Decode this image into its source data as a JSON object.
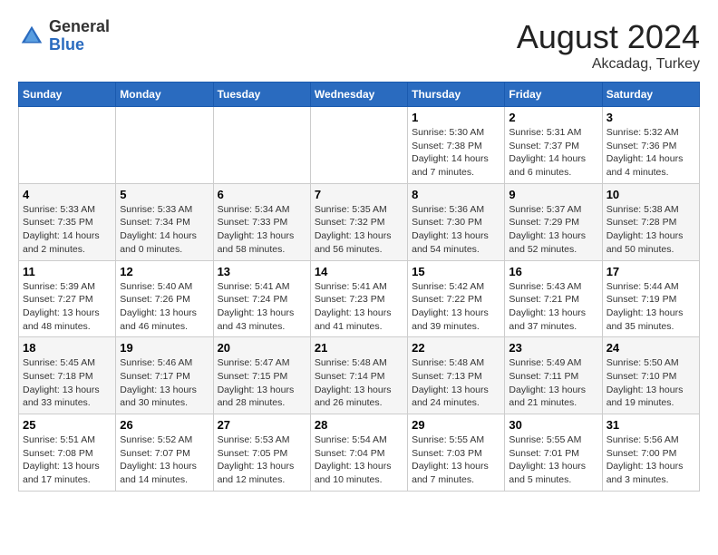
{
  "header": {
    "logo_general": "General",
    "logo_blue": "Blue",
    "month_year": "August 2024",
    "location": "Akcadag, Turkey"
  },
  "weekdays": [
    "Sunday",
    "Monday",
    "Tuesday",
    "Wednesday",
    "Thursday",
    "Friday",
    "Saturday"
  ],
  "weeks": [
    [
      {
        "day": "",
        "info": ""
      },
      {
        "day": "",
        "info": ""
      },
      {
        "day": "",
        "info": ""
      },
      {
        "day": "",
        "info": ""
      },
      {
        "day": "1",
        "info": "Sunrise: 5:30 AM\nSunset: 7:38 PM\nDaylight: 14 hours\nand 7 minutes."
      },
      {
        "day": "2",
        "info": "Sunrise: 5:31 AM\nSunset: 7:37 PM\nDaylight: 14 hours\nand 6 minutes."
      },
      {
        "day": "3",
        "info": "Sunrise: 5:32 AM\nSunset: 7:36 PM\nDaylight: 14 hours\nand 4 minutes."
      }
    ],
    [
      {
        "day": "4",
        "info": "Sunrise: 5:33 AM\nSunset: 7:35 PM\nDaylight: 14 hours\nand 2 minutes."
      },
      {
        "day": "5",
        "info": "Sunrise: 5:33 AM\nSunset: 7:34 PM\nDaylight: 14 hours\nand 0 minutes."
      },
      {
        "day": "6",
        "info": "Sunrise: 5:34 AM\nSunset: 7:33 PM\nDaylight: 13 hours\nand 58 minutes."
      },
      {
        "day": "7",
        "info": "Sunrise: 5:35 AM\nSunset: 7:32 PM\nDaylight: 13 hours\nand 56 minutes."
      },
      {
        "day": "8",
        "info": "Sunrise: 5:36 AM\nSunset: 7:30 PM\nDaylight: 13 hours\nand 54 minutes."
      },
      {
        "day": "9",
        "info": "Sunrise: 5:37 AM\nSunset: 7:29 PM\nDaylight: 13 hours\nand 52 minutes."
      },
      {
        "day": "10",
        "info": "Sunrise: 5:38 AM\nSunset: 7:28 PM\nDaylight: 13 hours\nand 50 minutes."
      }
    ],
    [
      {
        "day": "11",
        "info": "Sunrise: 5:39 AM\nSunset: 7:27 PM\nDaylight: 13 hours\nand 48 minutes."
      },
      {
        "day": "12",
        "info": "Sunrise: 5:40 AM\nSunset: 7:26 PM\nDaylight: 13 hours\nand 46 minutes."
      },
      {
        "day": "13",
        "info": "Sunrise: 5:41 AM\nSunset: 7:24 PM\nDaylight: 13 hours\nand 43 minutes."
      },
      {
        "day": "14",
        "info": "Sunrise: 5:41 AM\nSunset: 7:23 PM\nDaylight: 13 hours\nand 41 minutes."
      },
      {
        "day": "15",
        "info": "Sunrise: 5:42 AM\nSunset: 7:22 PM\nDaylight: 13 hours\nand 39 minutes."
      },
      {
        "day": "16",
        "info": "Sunrise: 5:43 AM\nSunset: 7:21 PM\nDaylight: 13 hours\nand 37 minutes."
      },
      {
        "day": "17",
        "info": "Sunrise: 5:44 AM\nSunset: 7:19 PM\nDaylight: 13 hours\nand 35 minutes."
      }
    ],
    [
      {
        "day": "18",
        "info": "Sunrise: 5:45 AM\nSunset: 7:18 PM\nDaylight: 13 hours\nand 33 minutes."
      },
      {
        "day": "19",
        "info": "Sunrise: 5:46 AM\nSunset: 7:17 PM\nDaylight: 13 hours\nand 30 minutes."
      },
      {
        "day": "20",
        "info": "Sunrise: 5:47 AM\nSunset: 7:15 PM\nDaylight: 13 hours\nand 28 minutes."
      },
      {
        "day": "21",
        "info": "Sunrise: 5:48 AM\nSunset: 7:14 PM\nDaylight: 13 hours\nand 26 minutes."
      },
      {
        "day": "22",
        "info": "Sunrise: 5:48 AM\nSunset: 7:13 PM\nDaylight: 13 hours\nand 24 minutes."
      },
      {
        "day": "23",
        "info": "Sunrise: 5:49 AM\nSunset: 7:11 PM\nDaylight: 13 hours\nand 21 minutes."
      },
      {
        "day": "24",
        "info": "Sunrise: 5:50 AM\nSunset: 7:10 PM\nDaylight: 13 hours\nand 19 minutes."
      }
    ],
    [
      {
        "day": "25",
        "info": "Sunrise: 5:51 AM\nSunset: 7:08 PM\nDaylight: 13 hours\nand 17 minutes."
      },
      {
        "day": "26",
        "info": "Sunrise: 5:52 AM\nSunset: 7:07 PM\nDaylight: 13 hours\nand 14 minutes."
      },
      {
        "day": "27",
        "info": "Sunrise: 5:53 AM\nSunset: 7:05 PM\nDaylight: 13 hours\nand 12 minutes."
      },
      {
        "day": "28",
        "info": "Sunrise: 5:54 AM\nSunset: 7:04 PM\nDaylight: 13 hours\nand 10 minutes."
      },
      {
        "day": "29",
        "info": "Sunrise: 5:55 AM\nSunset: 7:03 PM\nDaylight: 13 hours\nand 7 minutes."
      },
      {
        "day": "30",
        "info": "Sunrise: 5:55 AM\nSunset: 7:01 PM\nDaylight: 13 hours\nand 5 minutes."
      },
      {
        "day": "31",
        "info": "Sunrise: 5:56 AM\nSunset: 7:00 PM\nDaylight: 13 hours\nand 3 minutes."
      }
    ]
  ]
}
